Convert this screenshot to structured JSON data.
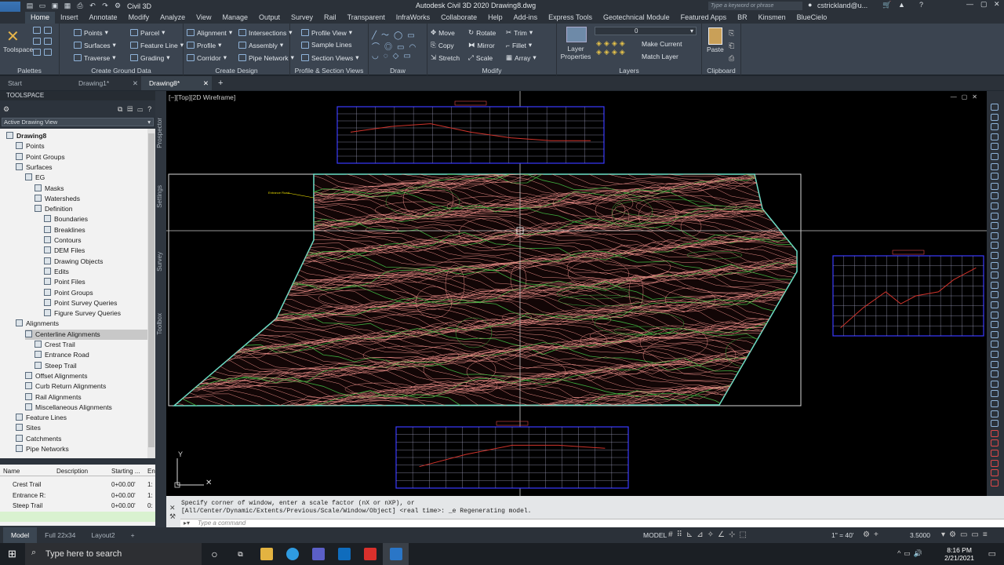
{
  "titlebar": {
    "workspace": "Civil 3D",
    "app_title": "Autodesk Civil 3D 2020    Drawing8.dwg",
    "search_placeholder": "Type a keyword or phrase",
    "user": "cstrickland@u..."
  },
  "menu": [
    "Home",
    "Insert",
    "Annotate",
    "Modify",
    "Analyze",
    "View",
    "Manage",
    "Output",
    "Survey",
    "Rail",
    "Transparent",
    "InfraWorks",
    "Collaborate",
    "Help",
    "Add-ins",
    "Express Tools",
    "Geotechnical Module",
    "Featured Apps",
    "BR",
    "Kinsmen",
    "BlueCielo"
  ],
  "ribbon": {
    "palettes": {
      "toolspace": "Toolspace",
      "title": "Palettes"
    },
    "ground": {
      "items": [
        "Points",
        "Surfaces",
        "Traverse",
        "Parcel",
        "Feature Line",
        "Grading"
      ],
      "title": "Create Ground Data"
    },
    "design": {
      "items": [
        "Alignment",
        "Profile",
        "Corridor",
        "Intersections",
        "Assembly",
        "Pipe Network"
      ],
      "title": "Create Design"
    },
    "profile": {
      "items": [
        "Profile View",
        "Sample Lines",
        "Section Views"
      ],
      "title": "Profile & Section Views"
    },
    "draw": {
      "title": "Draw"
    },
    "modify": {
      "items": [
        "Move",
        "Copy",
        "Stretch",
        "Rotate",
        "Mirror",
        "Scale",
        "Trim",
        "Fillet",
        "Array"
      ],
      "title": "Modify"
    },
    "layers": {
      "layer_properties": "Layer Properties",
      "current_layer": "0",
      "make_current": "Make Current",
      "match_layer": "Match Layer",
      "title": "Layers"
    },
    "clipboard": {
      "paste": "Paste",
      "title": "Clipboard"
    }
  },
  "doc_tabs": [
    "Start",
    "Drawing1*",
    "Drawing8*"
  ],
  "toolspace": {
    "header": "TOOLSPACE",
    "view": "Active Drawing View",
    "tree": [
      {
        "label": "Drawing8",
        "level": 0
      },
      {
        "label": "Points",
        "level": 1
      },
      {
        "label": "Point Groups",
        "level": 1
      },
      {
        "label": "Surfaces",
        "level": 1
      },
      {
        "label": "EG",
        "level": 2
      },
      {
        "label": "Masks",
        "level": 3
      },
      {
        "label": "Watersheds",
        "level": 3
      },
      {
        "label": "Definition",
        "level": 3
      },
      {
        "label": "Boundaries",
        "level": 4
      },
      {
        "label": "Breaklines",
        "level": 4
      },
      {
        "label": "Contours",
        "level": 4
      },
      {
        "label": "DEM Files",
        "level": 4
      },
      {
        "label": "Drawing Objects",
        "level": 4
      },
      {
        "label": "Edits",
        "level": 4
      },
      {
        "label": "Point Files",
        "level": 4
      },
      {
        "label": "Point Groups",
        "level": 4
      },
      {
        "label": "Point Survey Queries",
        "level": 4
      },
      {
        "label": "Figure Survey Queries",
        "level": 4
      },
      {
        "label": "Alignments",
        "level": 1
      },
      {
        "label": "Centerline Alignments",
        "level": 2
      },
      {
        "label": "Crest Trail",
        "level": 3
      },
      {
        "label": "Entrance Road",
        "level": 3
      },
      {
        "label": "Steep Trail",
        "level": 3
      },
      {
        "label": "Offset Alignments",
        "level": 2
      },
      {
        "label": "Curb Return Alignments",
        "level": 2
      },
      {
        "label": "Rail Alignments",
        "level": 2
      },
      {
        "label": "Miscellaneous Alignments",
        "level": 2
      },
      {
        "label": "Feature Lines",
        "level": 1
      },
      {
        "label": "Sites",
        "level": 1
      },
      {
        "label": "Catchments",
        "level": 1
      },
      {
        "label": "Pipe Networks",
        "level": 1
      }
    ],
    "table_headers": [
      "Name",
      "Description",
      "Starting ...",
      "En"
    ],
    "table_rows": [
      {
        "name": "Crest Trail",
        "desc": "",
        "start": "0+00.00'",
        "end": "1:"
      },
      {
        "name": "Entrance R:",
        "desc": "",
        "start": "0+00.00'",
        "end": "1:"
      },
      {
        "name": "Steep Trail",
        "desc": "",
        "start": "0+00.00'",
        "end": "0:"
      }
    ]
  },
  "side_tabs": [
    "Prospector",
    "Settings",
    "Survey",
    "Toolbox"
  ],
  "viewport": {
    "label": "[−][Top][2D Wireframe]"
  },
  "command": {
    "line1": "Specify corner of window, enter a scale factor (nX or nXP), or",
    "line2": "[All/Center/Dynamic/Extents/Previous/Scale/Window/Object] <real time>: _e Regenerating model.",
    "placeholder": "Type a command"
  },
  "status": {
    "layouts": [
      "Model",
      "Full 22x34",
      "Layout2"
    ],
    "model_label": "MODEL",
    "scale": "1\" = 40'",
    "value": "3.5000"
  },
  "taskbar": {
    "search_placeholder": "Type here to search",
    "time": "8:16 PM",
    "date": "2/21/2021"
  },
  "colors": {
    "accent": "#3b4652",
    "contour_major": "#e58a84",
    "contour_minor": "#3fae3f",
    "profile_frame": "#3a3aff"
  }
}
